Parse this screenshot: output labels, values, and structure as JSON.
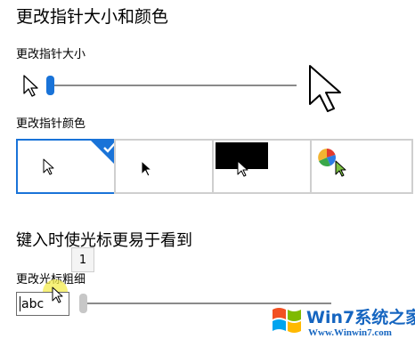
{
  "page": {
    "title": "更改指针大小和颜色",
    "size_section": {
      "label": "更改指针大小",
      "slider_level": 0.0
    },
    "color_section": {
      "label": "更改指针颜色",
      "options": [
        {
          "name": "white",
          "selected": true
        },
        {
          "name": "black",
          "selected": false
        },
        {
          "name": "inverted",
          "selected": false
        },
        {
          "name": "custom",
          "selected": false
        }
      ]
    },
    "text_cursor_section": {
      "title": "键入时使光标更易于看到",
      "label": "更改光标粗细",
      "tooltip_value": "1",
      "preview_text": "abc",
      "slider_level": 0.0
    }
  },
  "watermark": {
    "brand": "Win7系统之家",
    "url": "Www.Winwin7.com"
  },
  "colors": {
    "accent": "#1973d8",
    "highlight": "#f4ec4e"
  },
  "icons": [
    "pointer-small-icon",
    "pointer-large-icon",
    "check-icon",
    "color-wheel-icon",
    "windows-logo-icon"
  ]
}
